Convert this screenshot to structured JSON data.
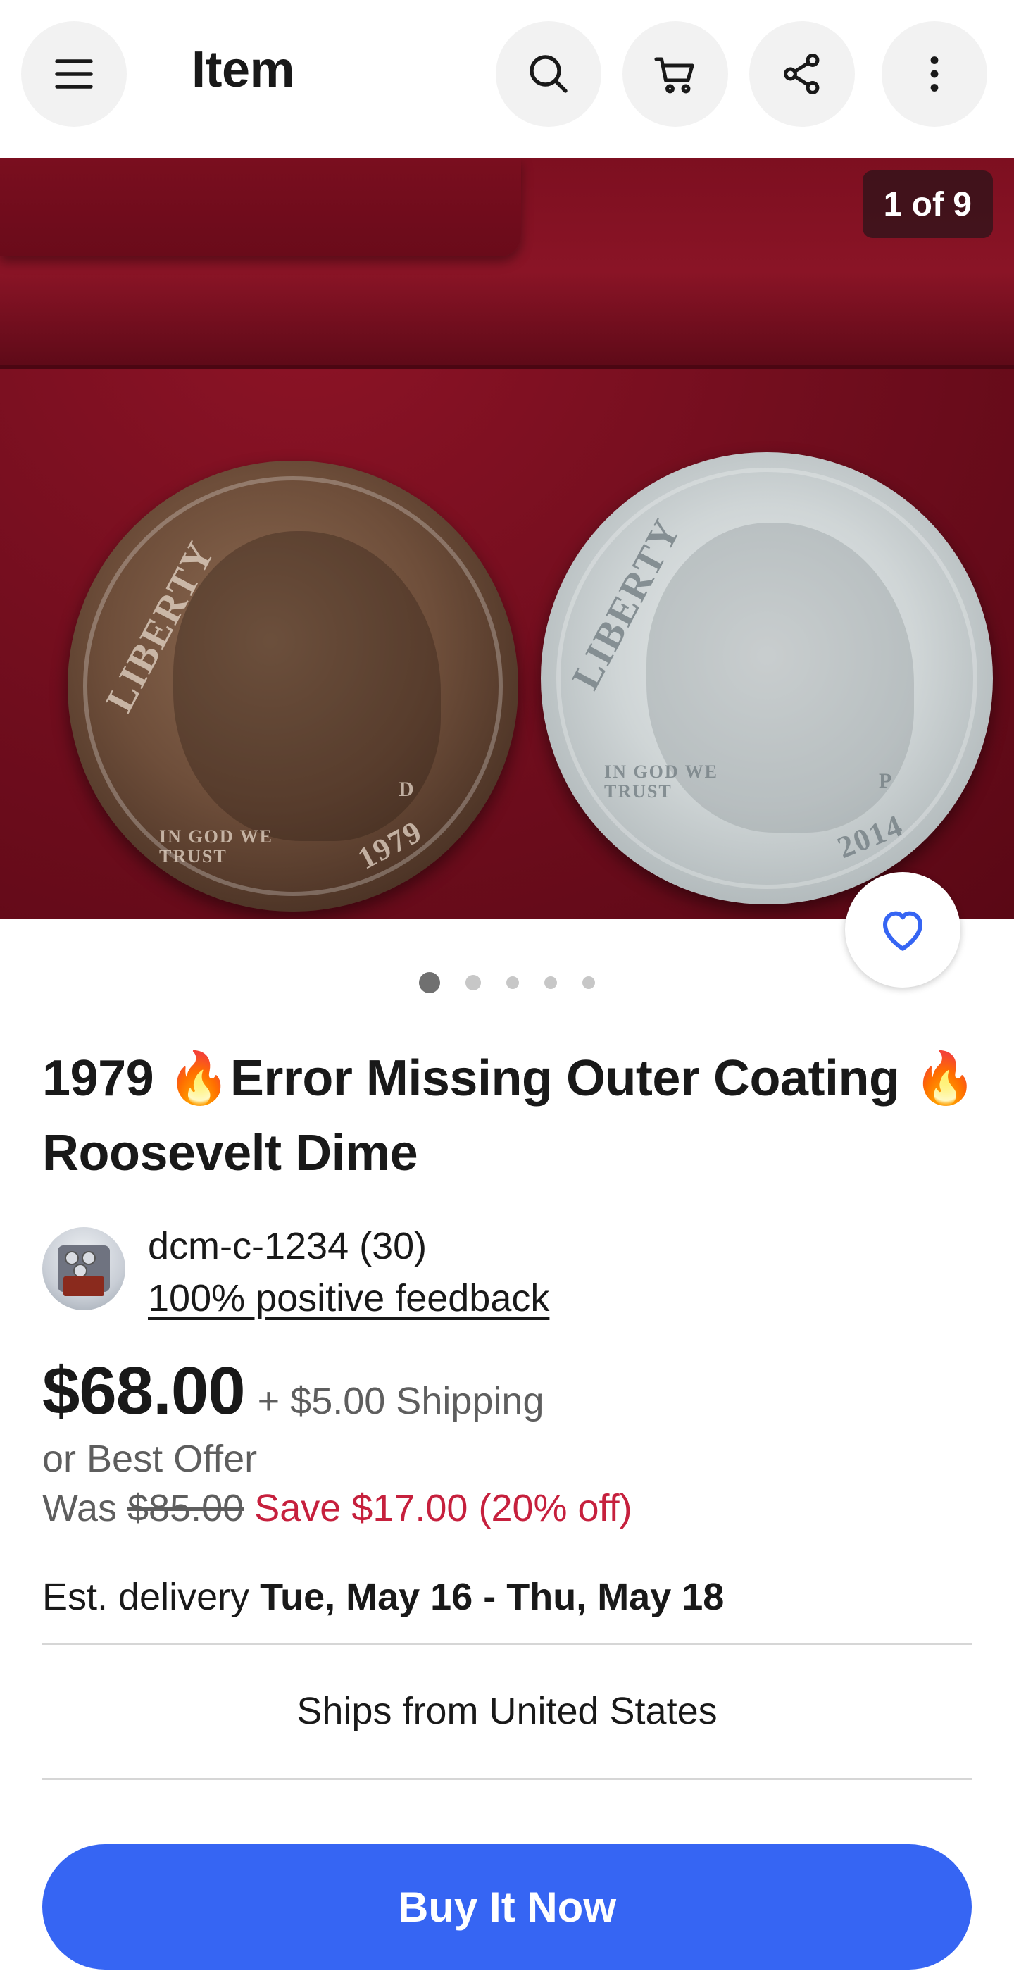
{
  "header": {
    "title": "Item",
    "icons": [
      "menu-icon",
      "search-icon",
      "cart-icon",
      "share-icon",
      "more-icon"
    ]
  },
  "gallery": {
    "counter": "1 of 9",
    "dots_visible": 5,
    "active_dot": 1,
    "photo_text": {
      "left_coin": {
        "liberty": "LIBERTY",
        "motto": "IN GOD WE TRUST",
        "year": "1979",
        "mint": "D"
      },
      "right_coin": {
        "liberty": "LIBERTY",
        "motto": "IN GOD WE TRUST",
        "year": "2014",
        "mint": "P"
      }
    }
  },
  "listing": {
    "title_part1": "1979 ",
    "flame1": "🔥",
    "title_part2": "Error Missing Outer Coating ",
    "flame2": "🔥",
    "title_part3": "Roosevelt Dime"
  },
  "seller": {
    "name": "dcm-c-1234 (30)",
    "feedback": "100% positive feedback"
  },
  "pricing": {
    "price": "$68.00",
    "shipping": "+ $5.00 Shipping",
    "best_offer": "or Best Offer",
    "was_label": "Was",
    "was_price": "$85.00",
    "save": "Save $17.00 (20% off)"
  },
  "delivery": {
    "label": "Est. delivery",
    "dates": "Tue, May 16 - Thu, May 18"
  },
  "ships_from": "Ships from United States",
  "buy_button": "Buy It Now",
  "colors": {
    "accent_blue": "#3665f3",
    "save_red": "#c6203d",
    "header_button_bg": "#f2f2f2"
  }
}
